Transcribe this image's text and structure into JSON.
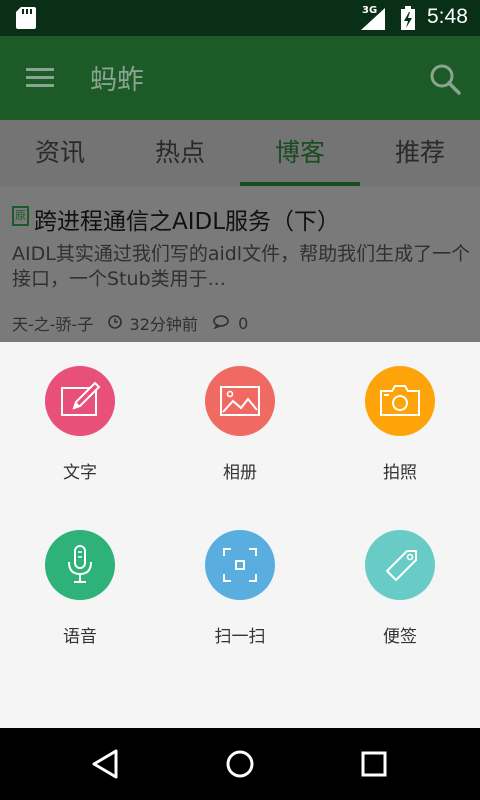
{
  "status_bar": {
    "network": "3G",
    "time": "5:48",
    "icons": [
      "sd-card-icon",
      "signal-icon",
      "battery-icon"
    ]
  },
  "app_bar": {
    "title": "蚂蚱",
    "menu_icon": "menu-icon",
    "search_icon": "search-icon"
  },
  "tabs": [
    {
      "label": "资讯",
      "active": false
    },
    {
      "label": "热点",
      "active": false
    },
    {
      "label": "博客",
      "active": true
    },
    {
      "label": "推荐",
      "active": false
    }
  ],
  "article": {
    "badge": "原",
    "title": "跨进程通信之AIDL服务（下）",
    "summary": "AIDL其实通过我们写的aidl文件，帮助我们生成了一个接口，一个Stub类用于...",
    "author": "天-之-骄-子",
    "time_ago": "32分钟前",
    "comments": "0"
  },
  "actions": [
    {
      "label": "文字",
      "icon": "edit-icon",
      "color": "#e8507a"
    },
    {
      "label": "相册",
      "icon": "image-icon",
      "color": "#f06a63"
    },
    {
      "label": "拍照",
      "icon": "camera-icon",
      "color": "#ffa30a"
    },
    {
      "label": "语音",
      "icon": "microphone-icon",
      "color": "#2fb27a"
    },
    {
      "label": "扫一扫",
      "icon": "scan-icon",
      "color": "#5aaedf"
    },
    {
      "label": "便签",
      "icon": "tag-icon",
      "color": "#69cbc5"
    }
  ],
  "nav_bar": [
    "back-icon",
    "home-icon",
    "recents-icon"
  ],
  "colors": {
    "status_bar": "#093016",
    "app_bar": "#1c5a28",
    "scrim_tabs": "#747474",
    "sheet": "#f5f5f5"
  }
}
